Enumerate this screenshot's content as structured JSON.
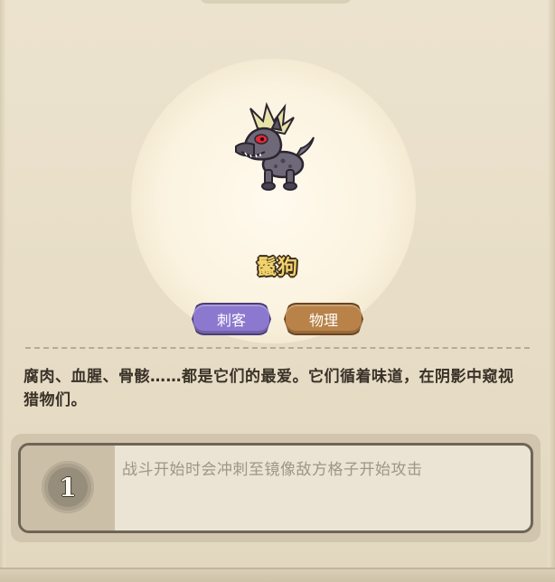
{
  "unit": {
    "name": "鬣狗",
    "tags": [
      "刺客",
      "物理"
    ],
    "description": "腐肉、血腥、骨骸……都是它们的最爱。它们循着味道，在阴影中窥视猎物们。",
    "portrait_icon": "hyena-portrait-icon"
  },
  "skill": {
    "level": "1",
    "text": "战斗开始时会冲刺至镜像敌方格子开始攻击"
  },
  "colors": {
    "name_text": "#f2d36c",
    "tag_assassin": "#8c79cf",
    "tag_physical": "#b98248"
  }
}
